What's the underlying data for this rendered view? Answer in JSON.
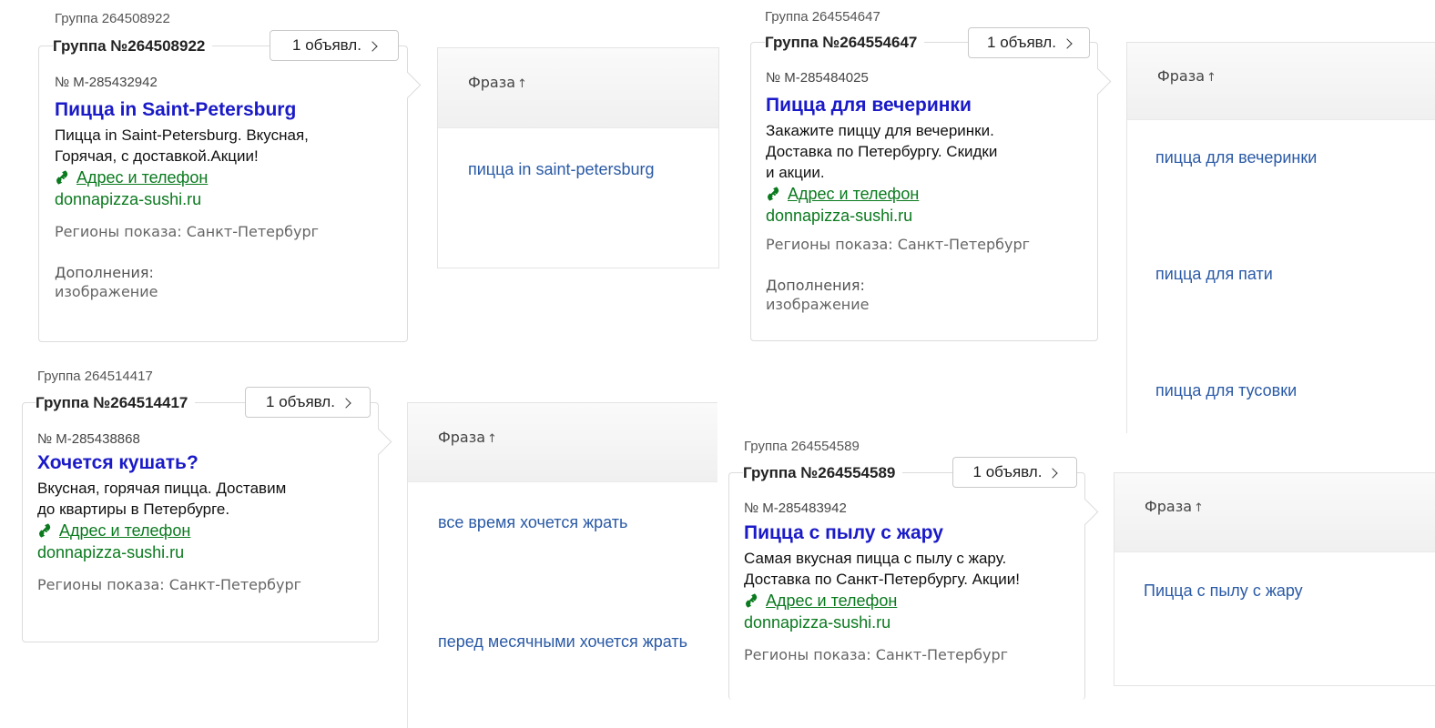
{
  "groups": [
    {
      "caption": "Группа 264508922",
      "title": "Группа №264508922",
      "ads_button": "1 объявл.",
      "ad": {
        "number": "№ М-285432942",
        "title": "Пицца in Saint-Petersburg",
        "text": [
          "Пицца in Saint-Petersburg. Вкусная,",
          "Горячая, с доставкой.Акции!"
        ],
        "contact_link": "Адрес и телефон",
        "domain": "donnapizza-sushi.ru",
        "regions": "Регионы показа: Санкт-Петербург",
        "extensions_label": "Дополнения:",
        "extensions_value": "изображение"
      },
      "table": {
        "header": "Фраза",
        "phrases": [
          "пицца in saint-petersburg"
        ]
      }
    },
    {
      "caption": "Группа 264554647",
      "title": "Группа №264554647",
      "ads_button": "1 объявл.",
      "ad": {
        "number": "№ М-285484025",
        "title": "Пицца для вечеринки",
        "text": [
          "Закажите пиццу для вечеринки.",
          "Доставка по Петербургу. Скидки",
          "и акции."
        ],
        "contact_link": "Адрес и телефон",
        "domain": "donnapizza-sushi.ru",
        "regions": "Регионы показа: Санкт-Петербург",
        "extensions_label": "Дополнения:",
        "extensions_value": "изображение"
      },
      "table": {
        "header": "Фраза",
        "phrases": [
          "пицца для вечеринки",
          "пицца для пати",
          "пицца для тусовки"
        ]
      }
    },
    {
      "caption": "Группа 264514417",
      "title": "Группа №264514417",
      "ads_button": "1 объявл.",
      "ad": {
        "number": "№ М-285438868",
        "title": "Хочется кушать?",
        "text": [
          "Вкусная, горячая пицца. Доставим",
          "до квартиры в Петербурге."
        ],
        "contact_link": "Адрес и телефон",
        "domain": "donnapizza-sushi.ru",
        "regions": "Регионы показа: Санкт-Петербург"
      },
      "table": {
        "header": "Фраза",
        "phrases": [
          "все время хочется жрать",
          "перед месячными хочется жрать"
        ]
      }
    },
    {
      "caption": "Группа 264554589",
      "title": "Группа №264554589",
      "ads_button": "1 объявл.",
      "ad": {
        "number": "№ М-285483942",
        "title": "Пицца с пылу с жару",
        "text": [
          "Самая вкусная пицца с пылу с жару.",
          "Доставка по Санкт-Петербургу. Акции!"
        ],
        "contact_link": "Адрес и телефон",
        "domain": "donnapizza-sushi.ru",
        "regions": "Регионы показа: Санкт-Петербург"
      },
      "table": {
        "header": "Фраза",
        "phrases": [
          "Пицца с пылу с жару"
        ]
      }
    }
  ],
  "colors": {
    "ad_title": "#1a1ac8",
    "ad_link": "#0a7a1e",
    "phrase": "#2a5aa6",
    "border": "#dcdcdc"
  },
  "icons": {
    "ads_button": "chevron-right-icon",
    "contact": "phone-icon",
    "sort": "arrow-up-icon"
  }
}
